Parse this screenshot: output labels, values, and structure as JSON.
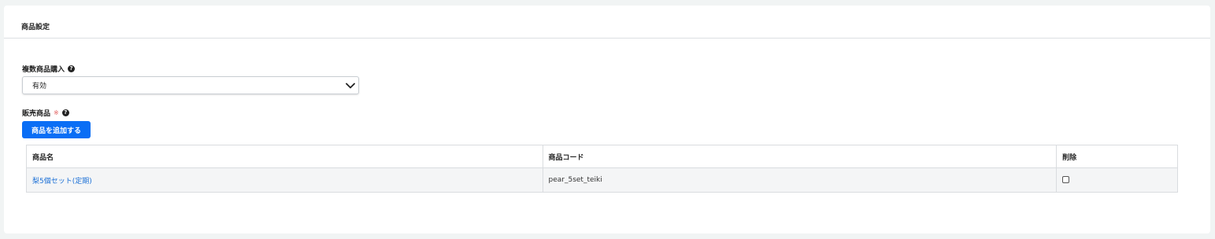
{
  "card": {
    "title": "商品設定"
  },
  "multi_purchase": {
    "label": "複数商品購入",
    "help_icon": "question-circle-icon",
    "selected_value": "有効"
  },
  "products": {
    "label": "販売商品",
    "required_mark": "※",
    "help_icon": "question-circle-icon",
    "add_button_label": "商品を追加する",
    "columns": [
      "商品名",
      "商品コード",
      "削除"
    ],
    "rows": [
      {
        "name": "梨5個セット(定期)",
        "code": "pear_5set_teiki",
        "delete_checked": false
      }
    ]
  },
  "colors": {
    "primary": "#0a6ef5",
    "link": "#1a6fd6",
    "required": "#e25b5b"
  }
}
